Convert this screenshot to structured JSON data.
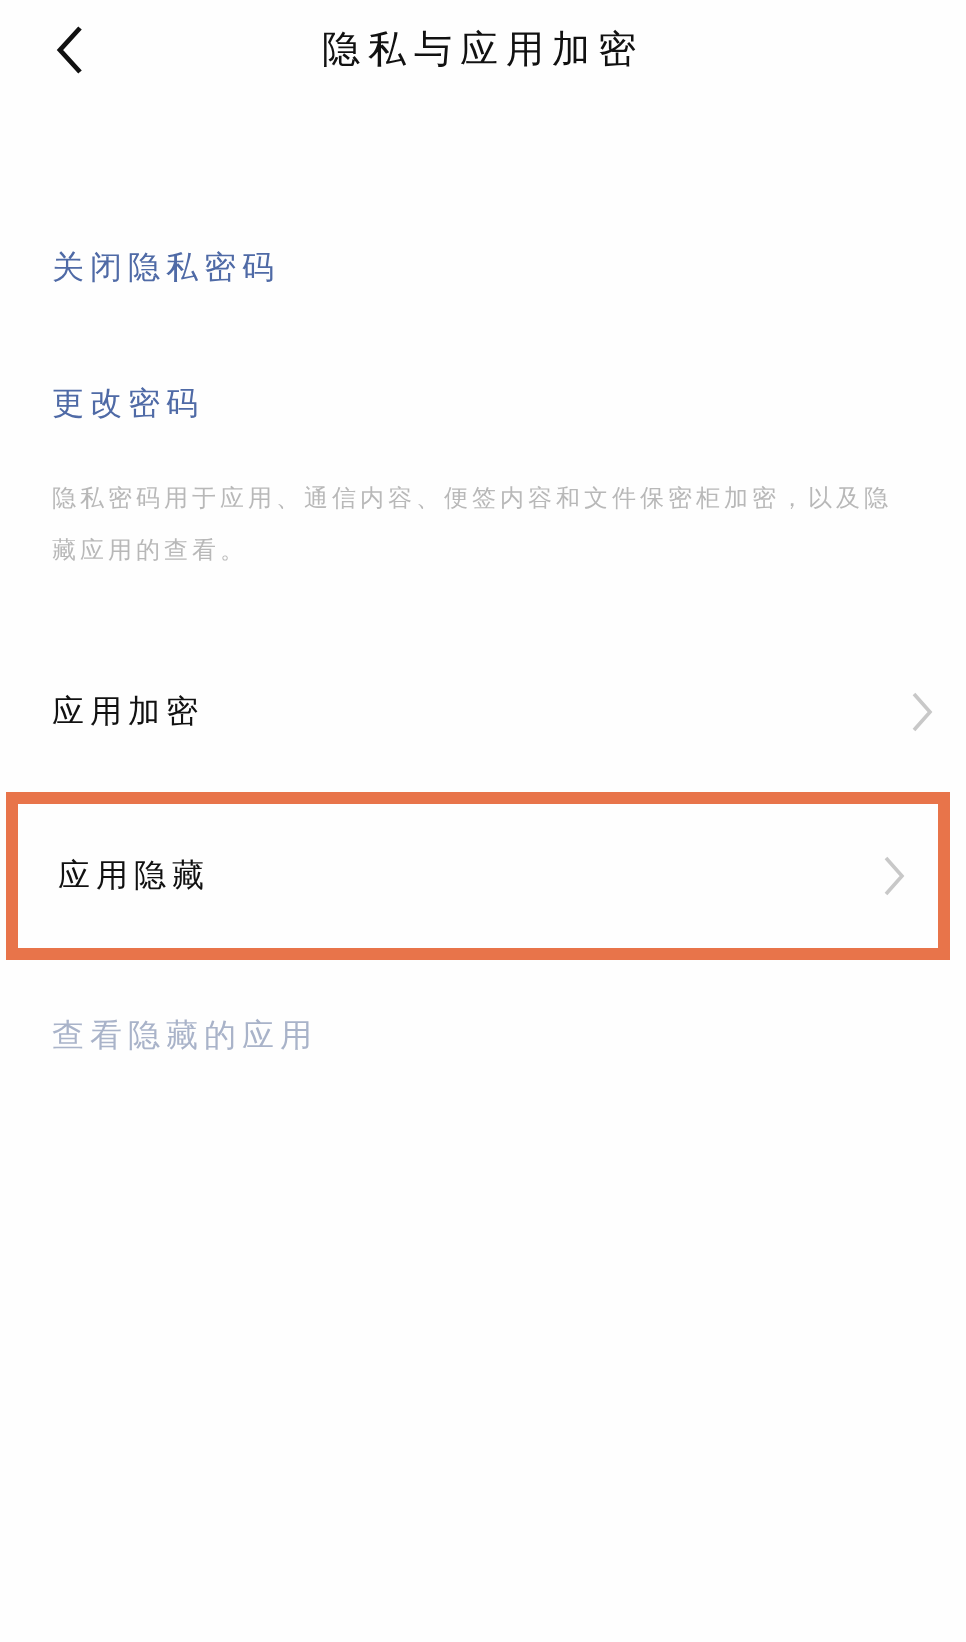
{
  "header": {
    "title": "隐私与应用加密"
  },
  "items": [
    {
      "kind": "link",
      "label": "关闭隐私密码",
      "disabled": false
    },
    {
      "kind": "link",
      "label": "更改密码",
      "disabled": false
    },
    {
      "kind": "note",
      "label": "隐私密码用于应用、通信内容、便签内容和文件保密柜加密，以及隐藏应用的查看。"
    },
    {
      "kind": "nav",
      "label": "应用加密",
      "highlighted": false
    },
    {
      "kind": "nav",
      "label": "应用隐藏",
      "highlighted": true
    },
    {
      "kind": "link",
      "label": "查看隐藏的应用",
      "disabled": true
    }
  ]
}
